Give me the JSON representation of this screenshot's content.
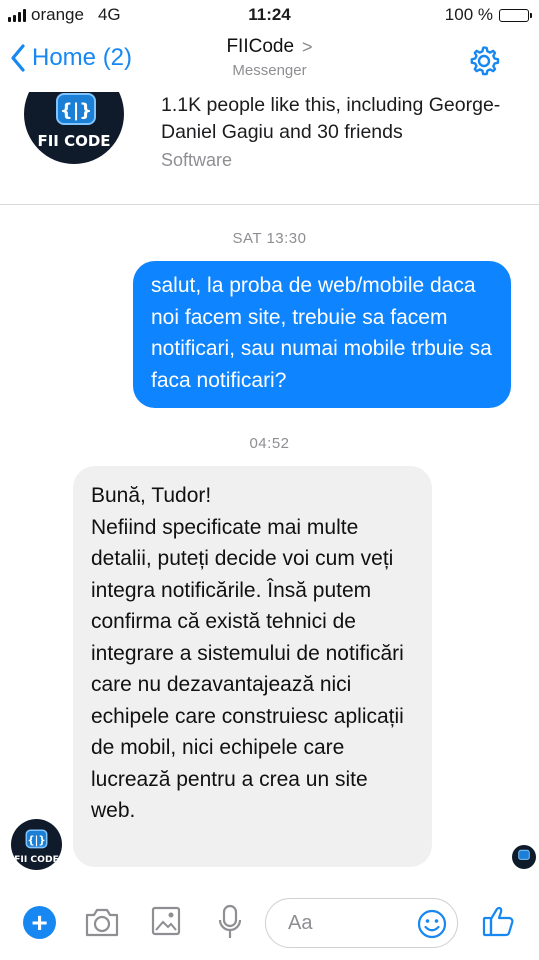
{
  "status_bar": {
    "carrier": "orange",
    "network": "4G",
    "time": "11:24",
    "battery": "100 %",
    "battery_level_percent": 100
  },
  "nav": {
    "back_label": "Home (2)",
    "title": "FIICode",
    "title_chevron": ">",
    "subtitle": "Messenger",
    "settings_icon": "gear-icon"
  },
  "page_card": {
    "likes_text": "1.1K people like this, including George-Daniel Gagiu and 30 friends",
    "category": "Software",
    "logo_mark": "{|}",
    "logo_text": "FII CODE"
  },
  "messages": [
    {
      "timestamp": "SAT 13:30",
      "direction": "outgoing",
      "text": "salut, la proba de web/mobile daca noi facem site, trebuie sa facem notificari, sau numai mobile trbuie sa faca notificari?"
    },
    {
      "timestamp": "04:52",
      "direction": "incoming",
      "greeting": "Bună, Tudor!",
      "text": "Nefiind specificate mai multe detalii, puteți decide voi cum veți integra notificările. Însă putem confirma că există tehnici de integrare a sistemului de notificări care nu dezavantajează nici echipele care construiesc aplicații de mobil, nici echipele care lucrează pentru a crea un site web."
    }
  ],
  "composer": {
    "placeholder": "Aa",
    "icons": [
      "plus-icon",
      "camera-icon",
      "image-icon",
      "microphone-icon",
      "emoji-icon",
      "thumbs-up-icon"
    ]
  },
  "colors": {
    "accent": "#1787f2",
    "outgoing_bubble": "#0f84ff",
    "incoming_bubble": "#f0f0f0",
    "secondary_text": "#8e8e93"
  }
}
